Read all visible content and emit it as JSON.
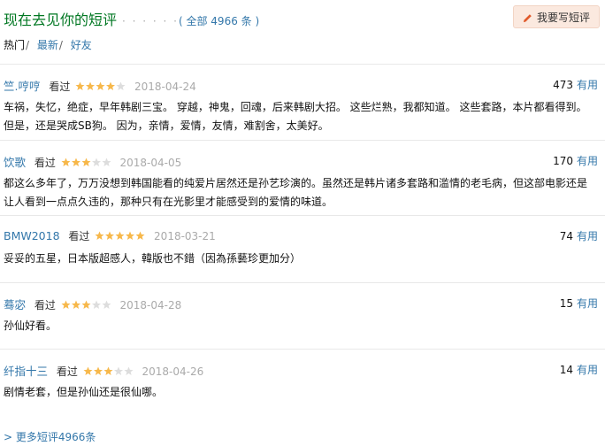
{
  "header": {
    "title": "现在去见你的短评",
    "dots": "· · · · · ·",
    "count_text": "( 全部 4966 条 )",
    "write_button": "我要写短评"
  },
  "tabs": [
    {
      "label": "热门",
      "active": true
    },
    {
      "label": "最新",
      "active": false
    },
    {
      "label": "好友",
      "active": false
    }
  ],
  "comments": [
    {
      "author": "竺.哼哼",
      "status": "看过",
      "rating": 4,
      "date": "2018-04-24",
      "votes": "473",
      "useful_label": "有用",
      "text": "车祸，失忆，绝症，早年韩剧三宝。 穿越，神鬼，回魂，后来韩剧大招。 这些烂熟，我都知道。 这些套路，本片都看得到。 但是，还是哭成SB狗。 因为，亲情，爱情，友情，难割舍，太美好。"
    },
    {
      "author": "饮歌",
      "status": "看过",
      "rating": 3,
      "date": "2018-04-05",
      "votes": "170",
      "useful_label": "有用",
      "text": "都这么多年了，万万没想到韩国能看的纯爱片居然还是孙艺珍演的。虽然还是韩片诸多套路和滥情的老毛病，但这部电影还是让人看到一点点久违的，那种只有在光影里才能感受到的爱情的味道。"
    },
    {
      "author": "BMW2018",
      "status": "看过",
      "rating": 5,
      "date": "2018-03-21",
      "votes": "74",
      "useful_label": "有用",
      "text": "妥妥的五星，日本版超感人，韓版也不錯（因為孫藝珍更加分）"
    },
    {
      "author": "蓦宓",
      "status": "看过",
      "rating": 3,
      "date": "2018-04-28",
      "votes": "15",
      "useful_label": "有用",
      "text": "孙仙好看。"
    },
    {
      "author": "纤指十三",
      "status": "看过",
      "rating": 3,
      "date": "2018-04-26",
      "votes": "14",
      "useful_label": "有用",
      "text": "剧情老套，但是孙仙还是很仙哪。"
    }
  ],
  "more_link": "> 更多短评4966条",
  "colors": {
    "title": "#007722",
    "link": "#3377aa",
    "star_on": "#f7b84b",
    "star_off": "#dddddd",
    "date": "#aaaaaa",
    "button_bg": "#fbe9df",
    "pencil": "#e05a2b"
  }
}
